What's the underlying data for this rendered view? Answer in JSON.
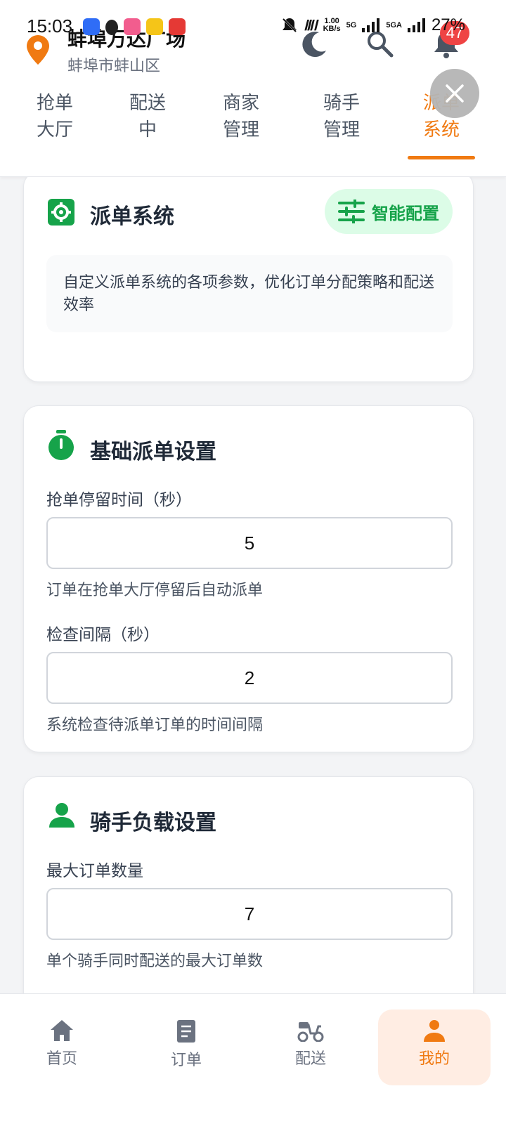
{
  "status_bar": {
    "time": "15:03",
    "net_speed_top": "1.00",
    "net_speed_unit": "KB/s",
    "sig1": "5G",
    "sig2": "5GA",
    "battery": "27%"
  },
  "header": {
    "location_name": "蚌埠万达广场",
    "location_area": "蚌埠市蚌山区",
    "notification_count": "47",
    "tabs": [
      {
        "line1": "抢单",
        "line2": "大厅"
      },
      {
        "line1": "配送",
        "line2": "中"
      },
      {
        "line1": "商家",
        "line2": "管理"
      },
      {
        "line1": "骑手",
        "line2": "管理"
      },
      {
        "line1": "派单",
        "line2": "系统"
      }
    ],
    "active_tab": 4
  },
  "dispatch_card": {
    "title": "派单系统",
    "smart_config_label": "智能配置",
    "description": "自定义派单系统的各项参数，优化订单分配策略和配送效率"
  },
  "basic_settings": {
    "title": "基础派单设置",
    "grab_stay_label": "抢单停留时间（秒）",
    "grab_stay_value": "5",
    "grab_stay_help": "订单在抢单大厅停留后自动派单",
    "check_interval_label": "检查间隔（秒）",
    "check_interval_value": "2",
    "check_interval_help": "系统检查待派单订单的时间间隔"
  },
  "rider_load": {
    "title": "骑手负载设置",
    "max_orders_label": "最大订单数量",
    "max_orders_value": "7",
    "max_orders_help": "单个骑手同时配送的最大订单数"
  },
  "bottom_nav": [
    {
      "label": "首页"
    },
    {
      "label": "订单"
    },
    {
      "label": "配送"
    },
    {
      "label": "我的"
    }
  ],
  "colors": {
    "accent": "#f07a12",
    "green": "#16a34a",
    "badge": "#ef4444"
  }
}
